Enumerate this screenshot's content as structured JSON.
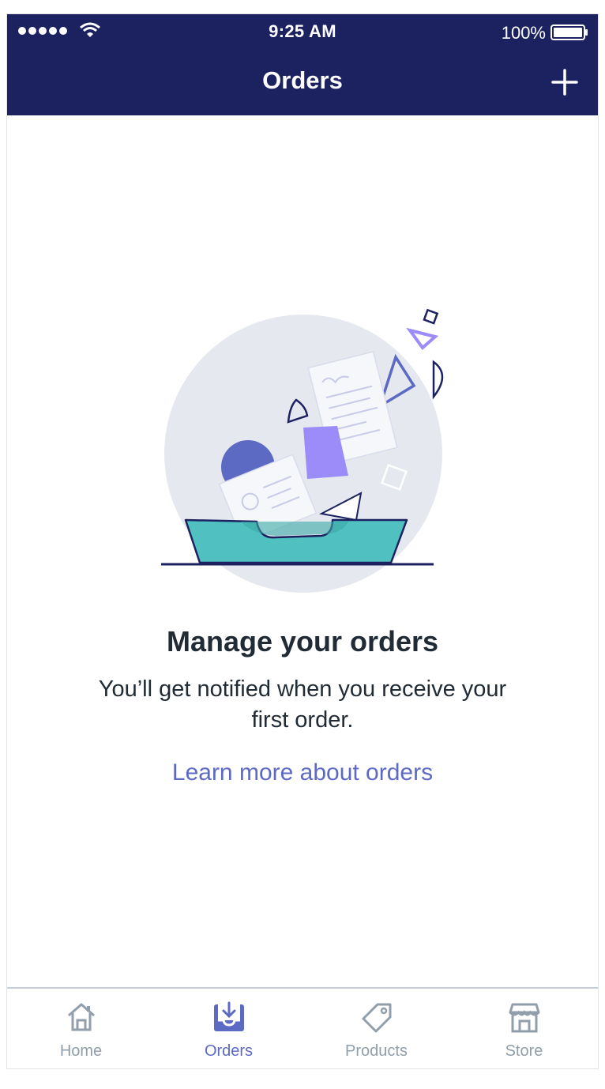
{
  "status_bar": {
    "time": "9:25 AM",
    "battery": "100%"
  },
  "header": {
    "title": "Orders",
    "add_icon": "plus-icon"
  },
  "empty_state": {
    "title": "Manage your orders",
    "body": "You’ll get notified when you receive your first order.",
    "link": "Learn more about orders",
    "illustration_icon": "orders-inbox-illustration"
  },
  "tabs": [
    {
      "label": "Home",
      "icon": "home-icon",
      "active": false
    },
    {
      "label": "Orders",
      "icon": "orders-inbox-icon",
      "active": true
    },
    {
      "label": "Products",
      "icon": "tag-icon",
      "active": false
    },
    {
      "label": "Store",
      "icon": "store-icon",
      "active": false
    }
  ],
  "colors": {
    "header_bg": "#1c2260",
    "accent": "#5c6ac4",
    "text": "#212b36",
    "tab_inactive": "#919eab",
    "teal": "#50c1c0",
    "violet": "#9c8cf9"
  }
}
